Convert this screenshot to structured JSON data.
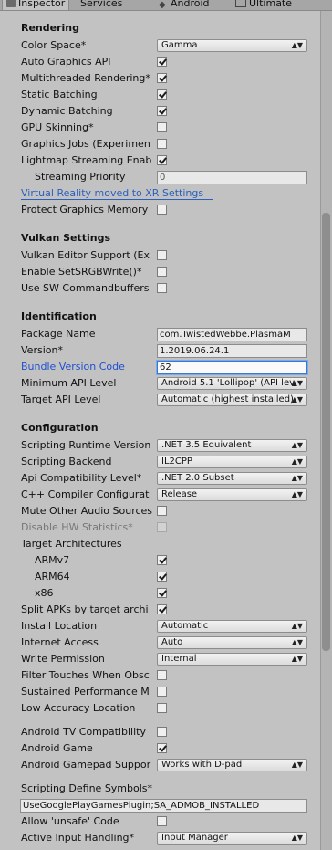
{
  "tabs": [
    "Inspector",
    "Services",
    "Android",
    "Ultimate"
  ],
  "rendering": {
    "header": "Rendering",
    "color_space_label": "Color Space*",
    "color_space_value": "Gamma",
    "auto_graphics_label": "Auto Graphics API",
    "multithreaded_label": "Multithreaded Rendering*",
    "static_batching_label": "Static Batching",
    "dynamic_batching_label": "Dynamic Batching",
    "gpu_skinning_label": "GPU Skinning*",
    "graphics_jobs_label": "Graphics Jobs (Experimen",
    "lightmap_streaming_label": "Lightmap Streaming Enab",
    "streaming_priority_label": "Streaming Priority",
    "streaming_priority_value": "0",
    "vr_link": "Virtual Reality moved to XR Settings",
    "protect_graphics_label": "Protect Graphics Memory"
  },
  "vulkan": {
    "header": "Vulkan Settings",
    "editor_support_label": "Vulkan Editor Support (Ex",
    "srgb_write_label": "Enable SetSRGBWrite()*",
    "sw_commandbuffers_label": "Use SW Commandbuffers"
  },
  "identification": {
    "header": "Identification",
    "package_name_label": "Package Name",
    "package_name_value": "com.TwistedWebbe.PlasmaM",
    "version_label": "Version*",
    "version_value": "1.2019.06.24.1",
    "bundle_code_label": "Bundle Version Code",
    "bundle_code_value": "62",
    "min_api_label": "Minimum API Level",
    "min_api_value": "Android 5.1 'Lollipop' (API lev",
    "target_api_label": "Target API Level",
    "target_api_value": "Automatic (highest installed)"
  },
  "configuration": {
    "header": "Configuration",
    "runtime_label": "Scripting Runtime Version",
    "runtime_value": ".NET 3.5 Equivalent",
    "backend_label": "Scripting Backend",
    "backend_value": "IL2CPP",
    "api_compat_label": "Api Compatibility Level*",
    "api_compat_value": ".NET 2.0 Subset",
    "cpp_compiler_label": "C++ Compiler Configurat",
    "cpp_compiler_value": "Release",
    "mute_audio_label": "Mute Other Audio Sources",
    "disable_hw_stats_label": "Disable HW Statistics*",
    "target_arch_label": "Target Architectures",
    "armv7_label": "ARMv7",
    "arm64_label": "ARM64",
    "x86_label": "x86",
    "split_apks_label": "Split APKs by target archi",
    "install_location_label": "Install Location",
    "install_location_value": "Automatic",
    "internet_access_label": "Internet Access",
    "internet_access_value": "Auto",
    "write_permission_label": "Write Permission",
    "write_permission_value": "Internal",
    "filter_touches_label": "Filter Touches When Obsc",
    "sustained_perf_label": "Sustained Performance M",
    "low_accuracy_label": "Low Accuracy Location",
    "android_tv_label": "Android TV Compatibility",
    "android_game_label": "Android Game",
    "gamepad_label": "Android Gamepad Suppor",
    "gamepad_value": "Works with D-pad",
    "define_symbols_label": "Scripting Define Symbols*",
    "define_symbols_value": "UseGooglePlayGamesPlugin;SA_ADMOB_INSTALLED",
    "allow_unsafe_label": "Allow 'unsafe' Code",
    "active_input_label": "Active Input Handling*",
    "active_input_value": "Input Manager"
  },
  "colors": {
    "background": "#c2c2c2",
    "link": "#2a5fbf",
    "focus": "#3a78d8"
  }
}
